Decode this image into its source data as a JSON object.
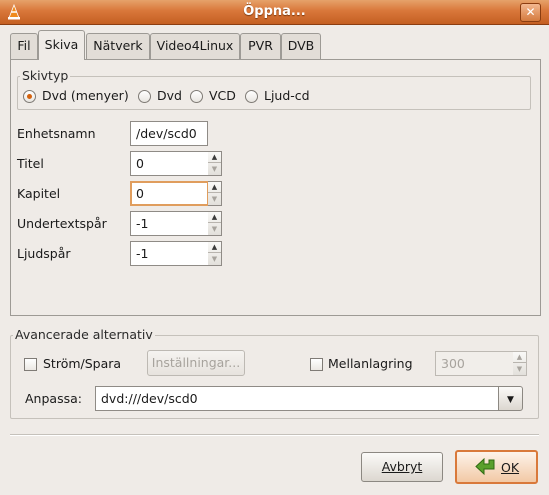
{
  "window": {
    "title": "Öppna..."
  },
  "tabs": [
    {
      "label": "Fil"
    },
    {
      "label": "Skiva",
      "active": true
    },
    {
      "label": "Nätverk"
    },
    {
      "label": "Video4Linux"
    },
    {
      "label": "PVR"
    },
    {
      "label": "DVB"
    }
  ],
  "disc_type": {
    "label": "Skivtyp",
    "options": [
      {
        "label": "Dvd (menyer)",
        "selected": true
      },
      {
        "label": "Dvd",
        "selected": false
      },
      {
        "label": "VCD",
        "selected": false
      },
      {
        "label": "Ljud-cd",
        "selected": false
      }
    ]
  },
  "fields": {
    "device": {
      "label": "Enhetsnamn",
      "value": "/dev/scd0"
    },
    "title": {
      "label": "Titel",
      "value": "0"
    },
    "chapter": {
      "label": "Kapitel",
      "value": "0"
    },
    "subtitle": {
      "label": "Undertextspår",
      "value": "-1"
    },
    "audio": {
      "label": "Ljudspår",
      "value": "-1"
    }
  },
  "advanced": {
    "label": "Avancerade alternativ",
    "stream_save": {
      "label": "Ström/Spara",
      "checked": false
    },
    "settings_button": "Inställningar...",
    "caching": {
      "label": "Mellanlagring",
      "checked": false,
      "value": "300"
    },
    "customize": {
      "label": "Anpassa:",
      "value": "dvd:///dev/scd0"
    }
  },
  "buttons": {
    "cancel": "Avbryt",
    "ok": "OK"
  },
  "colors": {
    "titlebar": "#d9773a",
    "accent": "#d4620e",
    "ok_icon": "#5aa02c"
  }
}
